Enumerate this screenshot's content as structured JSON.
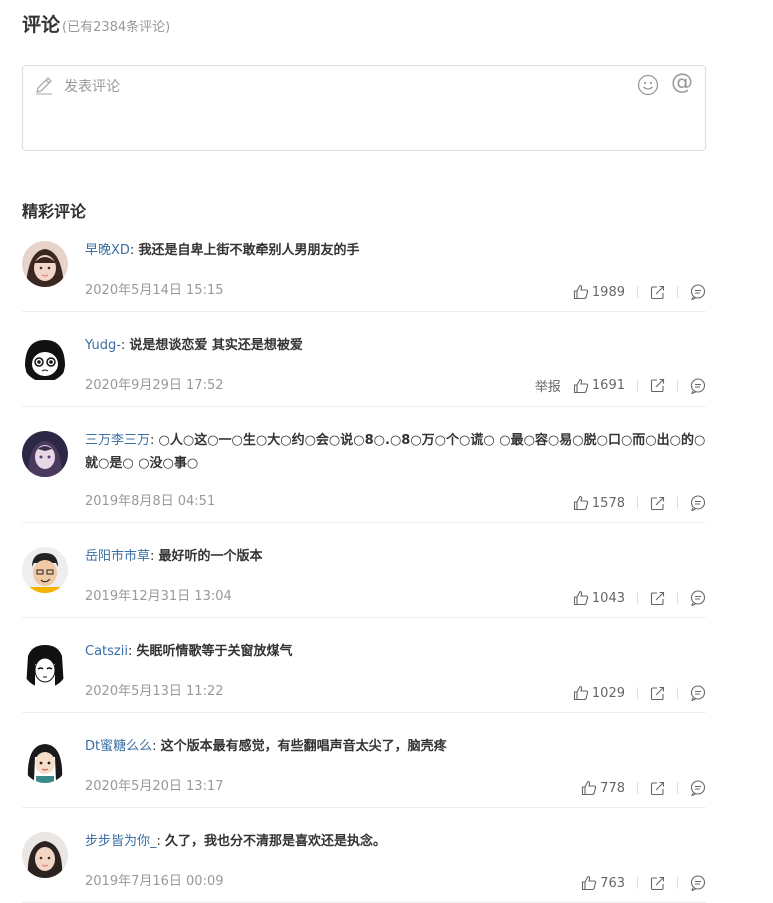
{
  "header": {
    "title": "评论",
    "count_text": "(已有2384条评论)"
  },
  "compose": {
    "placeholder": "发表评论",
    "icons": [
      "pencil-icon",
      "emoji-icon",
      "at-icon"
    ],
    "at_symbol": "@"
  },
  "section_title": "精彩评论",
  "comments": [
    {
      "user": "早晚XD",
      "text": "我还是自卑上街不敢牵别人男朋友的手",
      "time": "2020年5月14日 15:15",
      "likes": "1989",
      "report": ""
    },
    {
      "user": "Yudg-",
      "text": "说是想谈恋爱 其实还是想被爱",
      "time": "2020年9月29日 17:52",
      "likes": "1691",
      "report": "举报"
    },
    {
      "user": "三万李三万",
      "text": "○人○这○一○生○大○约○会○说○8○.○8○万○个○谎○ ○最○容○易○脱○口○而○出○的○就○是○ ○没○事○",
      "time": "2019年8月8日 04:51",
      "likes": "1578",
      "report": ""
    },
    {
      "user": "岳阳市市草",
      "text": "最好听的一个版本",
      "time": "2019年12月31日 13:04",
      "likes": "1043",
      "report": ""
    },
    {
      "user": "Catszii",
      "text": "失眠听情歌等于关窗放煤气",
      "time": "2020年5月13日 11:22",
      "likes": "1029",
      "report": ""
    },
    {
      "user": "Dt蜜糖么么",
      "text": "这个版本最有感觉，有些翻唱声音太尖了，脑壳疼",
      "time": "2020年5月20日 13:17",
      "likes": "778",
      "report": ""
    },
    {
      "user": "步步皆为你_",
      "text": "久了，我也分不清那是喜欢还是执念。",
      "time": "2019年7月16日 00:09",
      "likes": "763",
      "report": ""
    }
  ],
  "colors": {
    "username": "#3a6ea5",
    "meta": "#999999",
    "border": "#dddddd"
  }
}
